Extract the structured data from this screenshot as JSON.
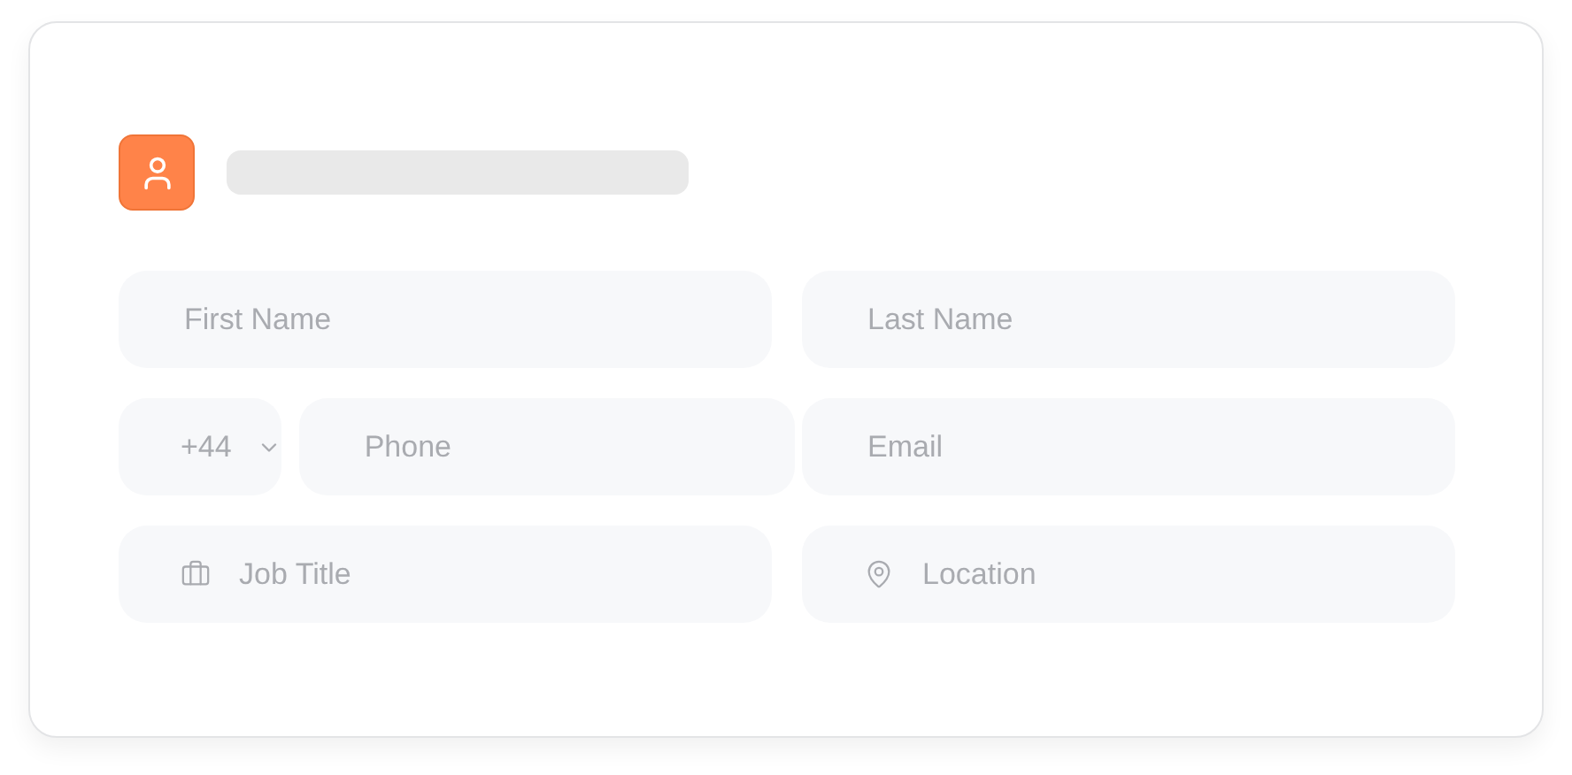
{
  "fields": [
    {
      "kind": "text",
      "placeholder": "First Name"
    },
    {
      "kind": "text",
      "placeholder": "Last Name"
    },
    {
      "kind": "phone",
      "country_code": "+44",
      "placeholder": "Phone"
    },
    {
      "kind": "text",
      "placeholder": "Email"
    },
    {
      "kind": "job",
      "placeholder": "Job Title"
    },
    {
      "kind": "location",
      "placeholder": "Location"
    }
  ]
}
